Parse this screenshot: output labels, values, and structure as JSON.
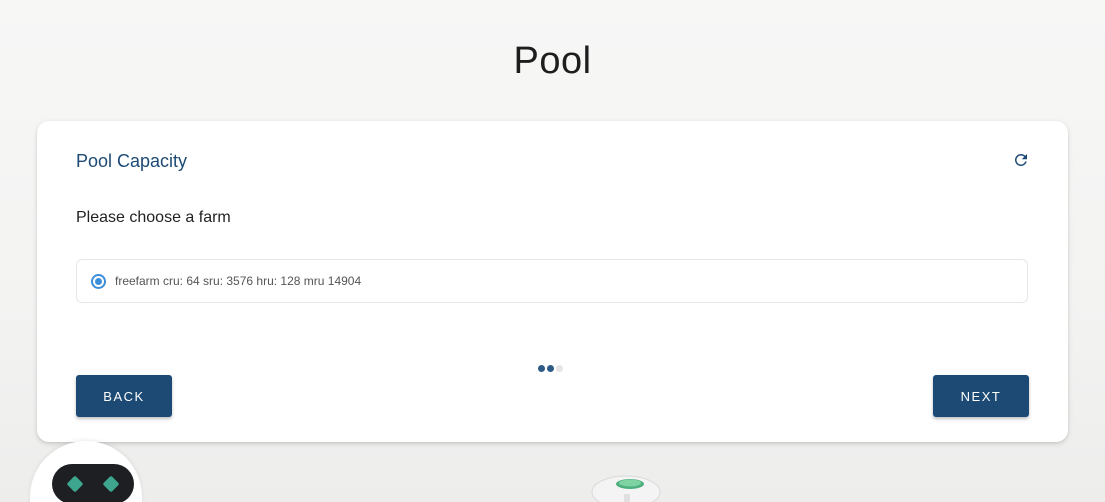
{
  "page": {
    "title": "Pool"
  },
  "card": {
    "title": "Pool Capacity",
    "prompt": "Please choose a farm",
    "refresh_icon": "refresh-icon",
    "options": [
      {
        "label": "freefarm cru: 64 sru: 3576 hru: 128 mru 14904",
        "selected": true
      }
    ],
    "stepper": {
      "total_steps": 3,
      "current_step": 2
    },
    "back_label": "BACK",
    "next_label": "NEXT"
  },
  "colors": {
    "primary": "#1c4a74",
    "radio_accent": "#3b8fd9",
    "robot_eyes": "#3ea58e"
  }
}
